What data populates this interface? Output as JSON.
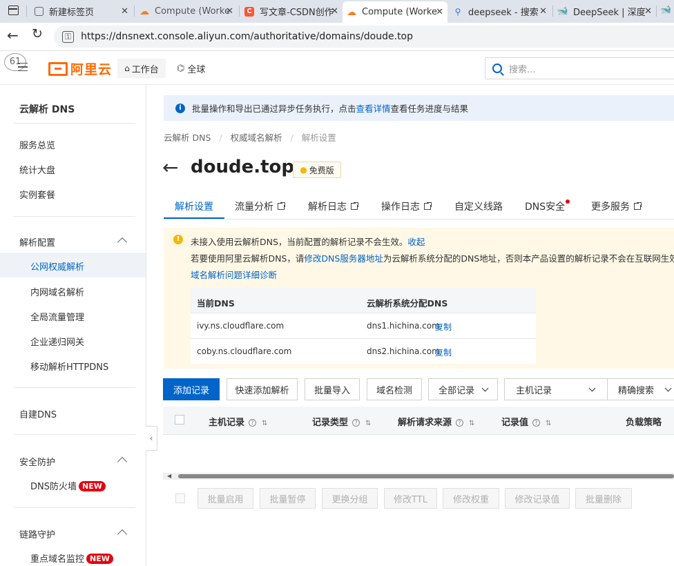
{
  "browser": {
    "tabs": [
      {
        "label": "新建标签页",
        "icon": "page-icon"
      },
      {
        "label": "Compute (Worke",
        "icon": "cloudflare-icon"
      },
      {
        "label": "写文章-CSDN创作",
        "icon": "csdn-icon"
      },
      {
        "label": "Compute (Worke",
        "icon": "cloudflare-icon"
      },
      {
        "label": "deepseek - 搜索",
        "icon": "search-icon"
      },
      {
        "label": "DeepSeek | 深度",
        "icon": "deepseek-icon"
      }
    ],
    "url_scheme": "https://",
    "url_host": "dnsnext.console.aliyun.com",
    "url_path": "/authoritative/domains/doude.top"
  },
  "header": {
    "avatar_number": "61",
    "logo_text": "阿里云",
    "workbench": "工作台",
    "region": "全球",
    "search_placeholder": "搜索..."
  },
  "sidebar": {
    "title": "云解析 DNS",
    "items": [
      "服务总览",
      "统计大盘",
      "实例套餐"
    ],
    "group_resolve": "解析配置",
    "resolve_items": [
      "公网权威解析",
      "内网域名解析",
      "全局流量管理",
      "企业递归网关",
      "移动解析HTTPDNS"
    ],
    "self_dns": "自建DNS",
    "group_security": "安全防护",
    "dns_firewall": "DNS防火墙",
    "group_link": "链路守护",
    "key_monitor": "重点域名监控",
    "new_badge": "NEW"
  },
  "notice": {
    "text_pre": "批量操作和导出已通过异步任务执行，点击",
    "link": "查看详情",
    "text_post": "查看任务进度与结果"
  },
  "breadcrumb": [
    "云解析 DNS",
    "权威域名解析",
    "解析设置"
  ],
  "domain": {
    "name": "doude.top",
    "edition": "免费版"
  },
  "tabs": [
    {
      "label": "解析设置",
      "external": false
    },
    {
      "label": "流量分析",
      "external": true
    },
    {
      "label": "解析日志",
      "external": true
    },
    {
      "label": "操作日志",
      "external": true
    },
    {
      "label": "自定义线路",
      "external": false
    },
    {
      "label": "DNS安全",
      "external": false
    },
    {
      "label": "更多服务",
      "external": true
    }
  ],
  "warning": {
    "line1": "未接入使用云解析DNS，当前配置的解析记录不会生效。",
    "collapse": "收起",
    "line2_pre": "若要使用阿里云解析DNS，请",
    "line2_link": "修改DNS服务器地址",
    "line2_post": "为云解析系统分配的DNS地址，否则本产品设置的解析记录不会在互联网生效。",
    "diagnose_link": "域名解析问题详细诊断",
    "table": {
      "col_current": "当前DNS",
      "col_assigned": "云解析系统分配DNS",
      "rows": [
        {
          "current": "ivy.ns.cloudflare.com",
          "assigned": "dns1.hichina.com"
        },
        {
          "current": "coby.ns.cloudflare.com",
          "assigned": "dns2.hichina.com"
        }
      ],
      "copy": "复制"
    }
  },
  "toolbar": {
    "add": "添加记录",
    "quick_add": "快速添加解析",
    "batch_import": "批量导入",
    "domain_check": "域名检测",
    "all_records": "全部记录",
    "host_record": "主机记录",
    "exact_search": "精确搜索"
  },
  "table": {
    "headers": [
      "主机记录",
      "记录类型",
      "解析请求来源",
      "记录值",
      "负载策略"
    ]
  },
  "batch": [
    "批量启用",
    "批量暂停",
    "更换分组",
    "修改TTL",
    "修改权重",
    "修改记录值",
    "批量删除"
  ],
  "colors": {
    "accent": "#0064c8",
    "brand_orange": "#ff6a00",
    "warning_bg": "#fff8e6",
    "badge_red": "#e4000f"
  }
}
